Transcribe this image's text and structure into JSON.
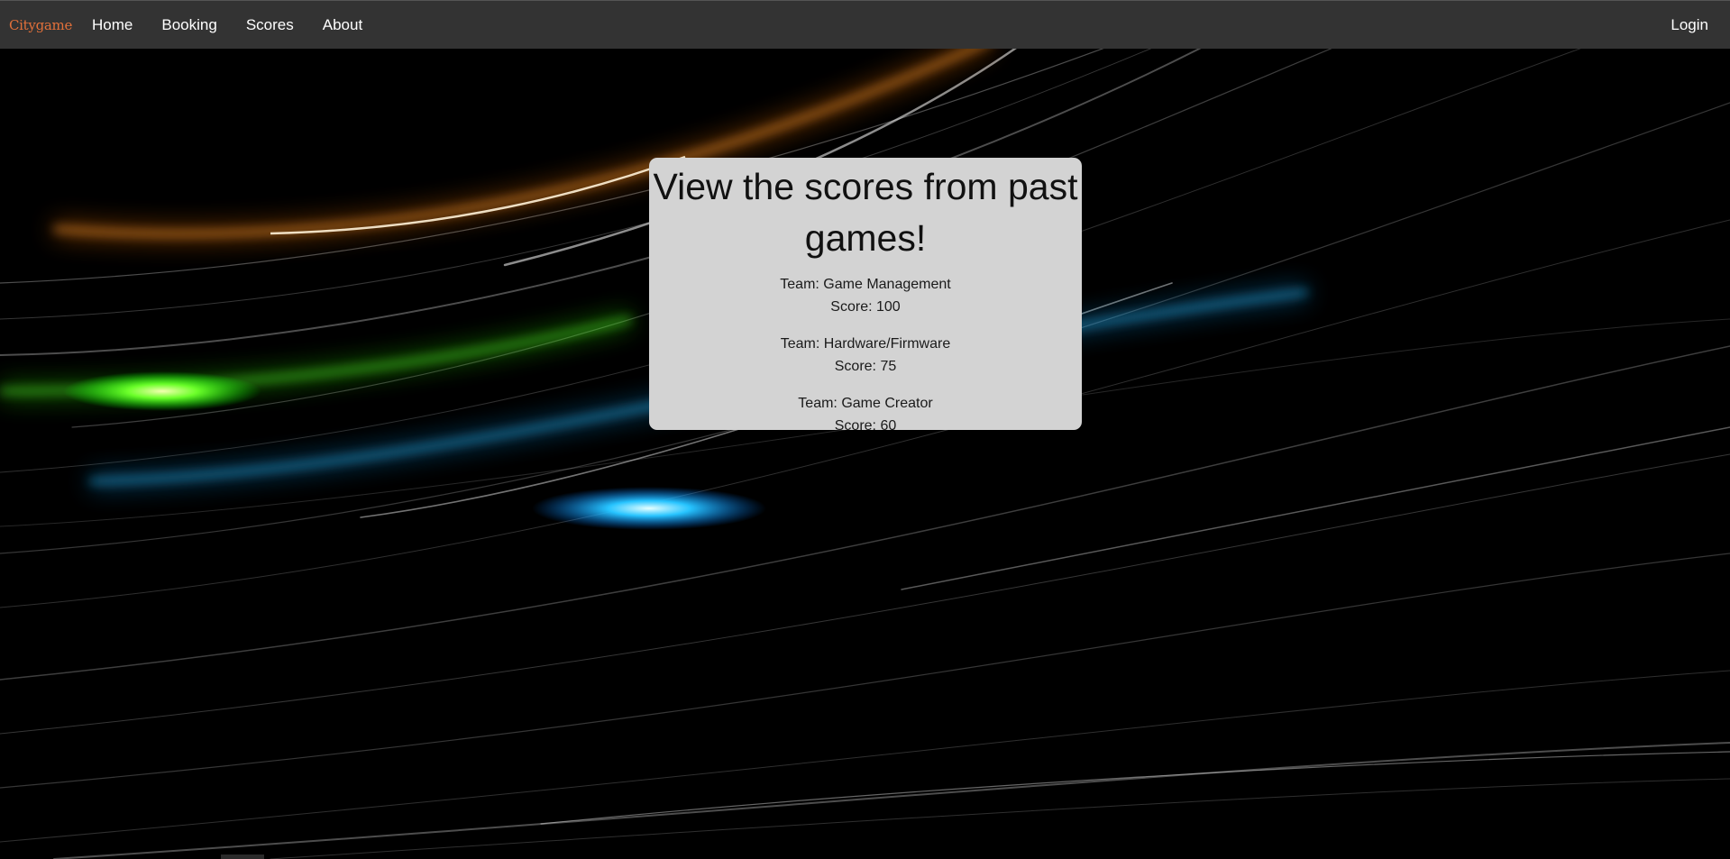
{
  "nav": {
    "brand": "Citygame",
    "links": [
      "Home",
      "Booking",
      "Scores",
      "About"
    ],
    "login": "Login"
  },
  "main": {
    "title": "View the scores from past games!",
    "scores": [
      {
        "team": "Team: Game Management",
        "score": "Score: 100"
      },
      {
        "team": "Team: Hardware/Firmware",
        "score": "Score: 75"
      },
      {
        "team": "Team: Game Creator",
        "score": "Score: 60"
      }
    ]
  },
  "colors": {
    "navbar": "#333333",
    "brand": "#e2703a",
    "card": "#d3d3d3",
    "background": "#000000"
  }
}
